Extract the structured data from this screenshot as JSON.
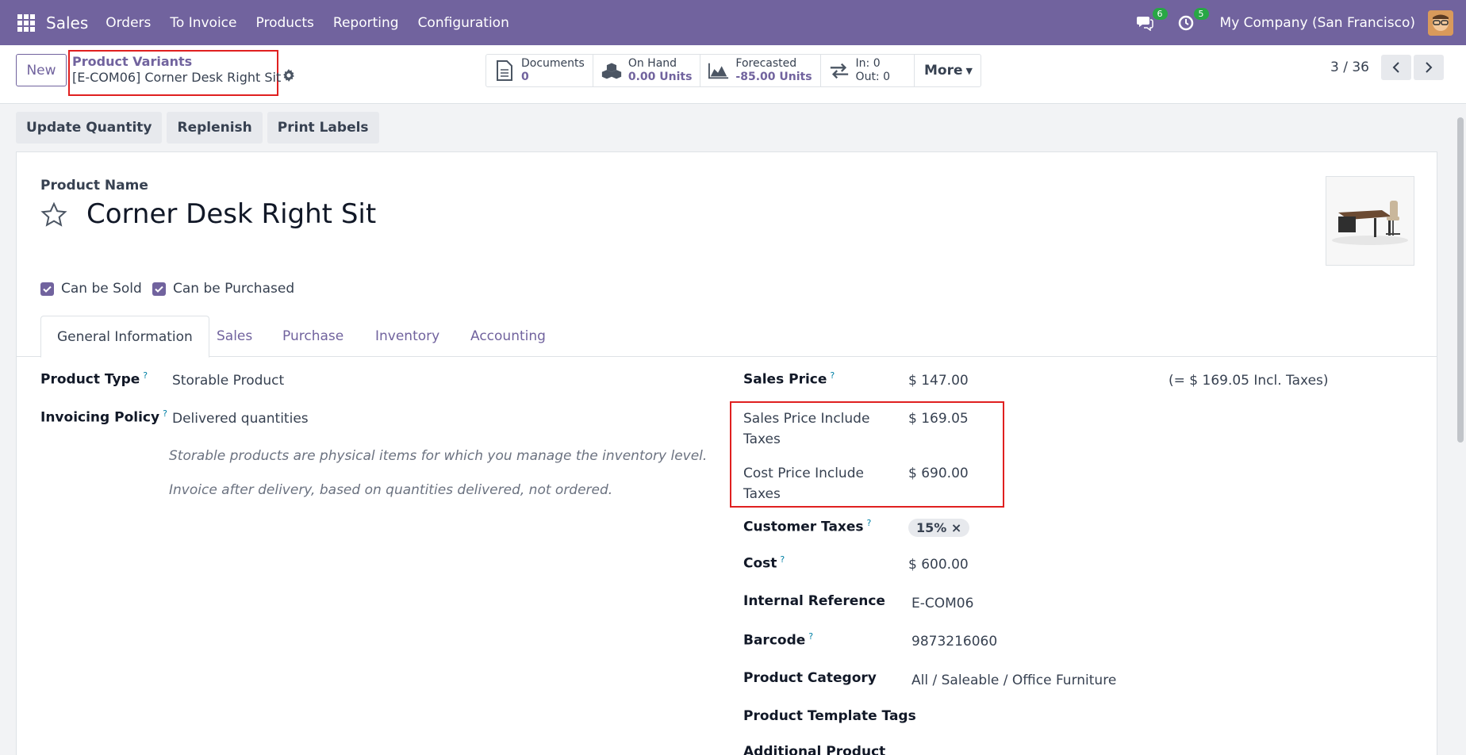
{
  "navbar": {
    "brand": "Sales",
    "menu": [
      "Orders",
      "To Invoice",
      "Products",
      "Reporting",
      "Configuration"
    ],
    "messages_count": "6",
    "activities_count": "5",
    "company": "My Company (San Francisco)"
  },
  "control": {
    "new_label": "New",
    "breadcrumb_parent": "Product Variants",
    "breadcrumb_current": "[E-COM06] Corner Desk Right Sit",
    "stats": {
      "documents_label": "Documents",
      "documents_value": "0",
      "onhand_label": "On Hand",
      "onhand_value": "0.00 Units",
      "forecasted_label": "Forecasted",
      "forecasted_value": "-85.00 Units",
      "in_label": "In: 0",
      "out_label": "Out: 0",
      "more_label": "More"
    },
    "pager": "3 / 36"
  },
  "actions": [
    "Update Quantity",
    "Replenish",
    "Print Labels"
  ],
  "form": {
    "product_name_label": "Product Name",
    "product_name": "Corner Desk Right Sit",
    "can_be_sold": "Can be Sold",
    "can_be_purchased": "Can be Purchased",
    "tabs": [
      "General Information",
      "Sales",
      "Purchase",
      "Inventory",
      "Accounting"
    ],
    "product_type_label": "Product Type",
    "product_type": "Storable Product",
    "invoicing_policy_label": "Invoicing Policy",
    "invoicing_policy": "Delivered quantities",
    "note_storable": "Storable products are physical items for which you manage the inventory level.",
    "note_invoice": "Invoice after delivery, based on quantities delivered, not ordered.",
    "sales_price_label": "Sales Price",
    "sales_price": "$ 147.00",
    "incl_taxes": "(= $ 169.05 Incl. Taxes)",
    "sp_incl_label_1": "Sales Price Include",
    "sp_incl_label_2": "Taxes",
    "sp_incl_value": "$ 169.05",
    "cp_incl_label_1": "Cost Price Include",
    "cp_incl_label_2": "Taxes",
    "cp_incl_value": "$ 690.00",
    "customer_taxes_label": "Customer Taxes",
    "customer_taxes_tag": "15%",
    "cost_label": "Cost",
    "cost": "$ 600.00",
    "internal_ref_label": "Internal Reference",
    "internal_ref": "E-COM06",
    "barcode_label": "Barcode",
    "barcode": "9873216060",
    "category_label": "Product Category",
    "category": "All / Saleable / Office Furniture",
    "template_tags_label": "Product Template Tags",
    "additional_label": "Additional Product"
  },
  "colors": {
    "brand": "#71639e",
    "highlight": "#e02020",
    "badge": "#28a745"
  }
}
